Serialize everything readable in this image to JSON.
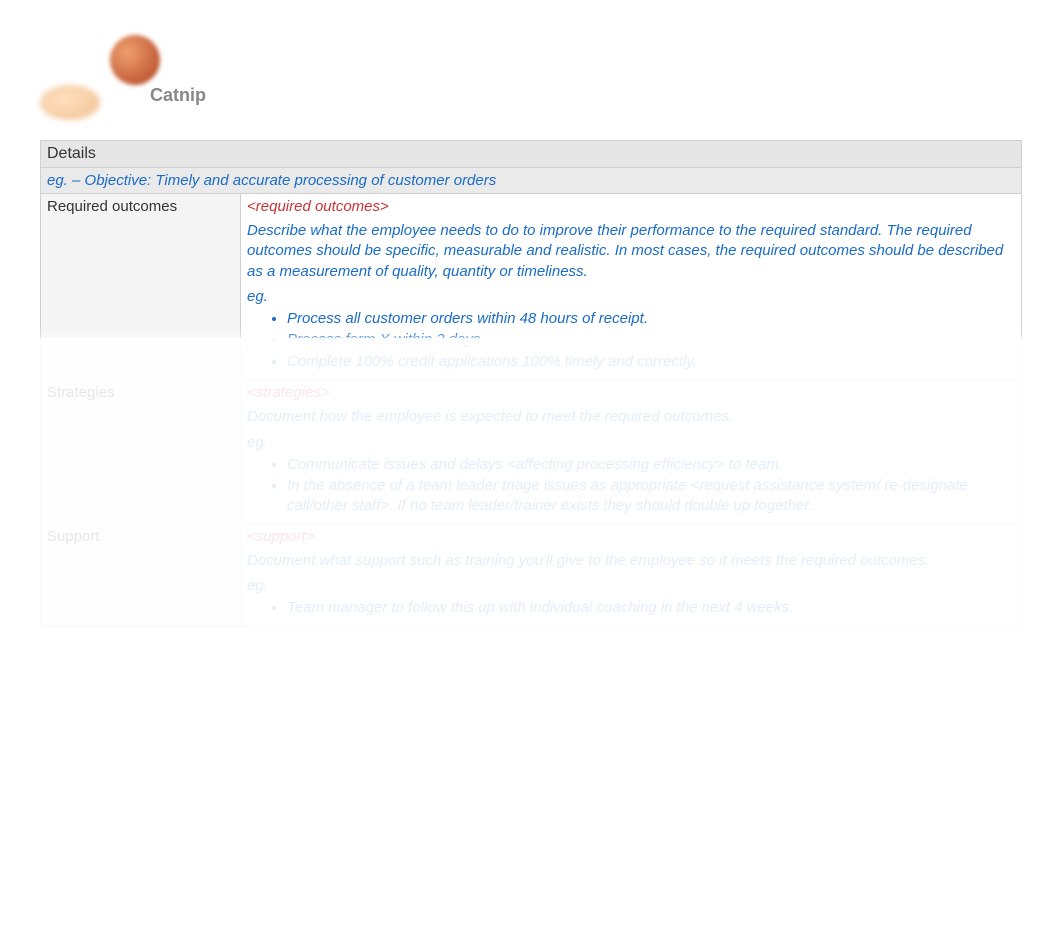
{
  "logo": {
    "text": "Catnip"
  },
  "table": {
    "details_label": "Details",
    "objective_example": "eg. – Objective: Timely and accurate processing of customer orders",
    "rows": [
      {
        "label": "Required outcomes",
        "placeholder": "<required outcomes>",
        "description": "Describe what the employee needs to do to improve their performance to the required standard. The required outcomes should be specific, measurable and realistic. In most cases, the required outcomes should be described as a measurement of quality, quantity or timeliness.",
        "eg_label": "eg.",
        "items": [
          "Process all customer orders within 48 hours of receipt.",
          "Process form X within 3 days.",
          "Complete 100% credit applications 100% timely and correctly."
        ]
      },
      {
        "label": "Strategies",
        "placeholder": "<strategies>",
        "description": "Document how the employee is expected to meet the required outcomes.",
        "eg_label": "eg.",
        "items": [
          "Communicate issues and delays <affecting processing efficiency> to team.",
          "In the absence of a team leader triage issues as appropriate <request assistance system/ re-designate call/other staff>. If no team leader/trainer exists they should double up together."
        ]
      },
      {
        "label": "Support",
        "placeholder": "<support>",
        "description": "Document what support such as training you'll give to the employee so it meets the required outcomes.",
        "eg_label": "eg.",
        "items": [
          "Team manager to follow this up with individual coaching in the next 4 weeks."
        ]
      }
    ]
  }
}
